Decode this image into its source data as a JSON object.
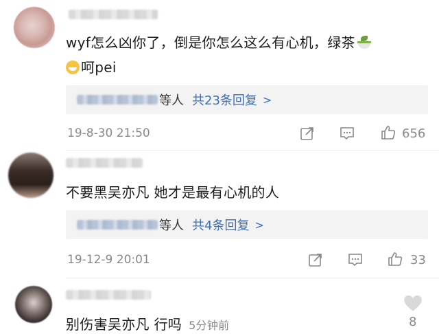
{
  "comments": [
    {
      "text": "wyf怎么凶你了，倒是你怎么这么有心机，绿茶",
      "text_line2": "呵pei",
      "reply_suffix": "等人",
      "reply_count": "共23条回复",
      "reply_chevron": ">",
      "timestamp": "19-8-30 21:50",
      "likes": "656"
    },
    {
      "text": "不要黑吴亦凡 她才是最有心机的人",
      "reply_suffix": "等人",
      "reply_count": "共4条回复",
      "reply_chevron": ">",
      "timestamp": "19-12-9 20:01",
      "likes": "33"
    },
    {
      "text": "别伤害吴亦凡 行吗",
      "time_ago": "5分钟前",
      "likes": "8"
    }
  ],
  "icons": {
    "share": "share-icon",
    "comment": "comment-icon",
    "like": "thumbs-up-icon",
    "heart": "heart-icon",
    "tea": "green-tea-emoji",
    "grin": "grinning-face-emoji"
  },
  "colors": {
    "link": "#3d6fb5",
    "muted": "#888888",
    "reply_bg": "#f3f3f3"
  }
}
